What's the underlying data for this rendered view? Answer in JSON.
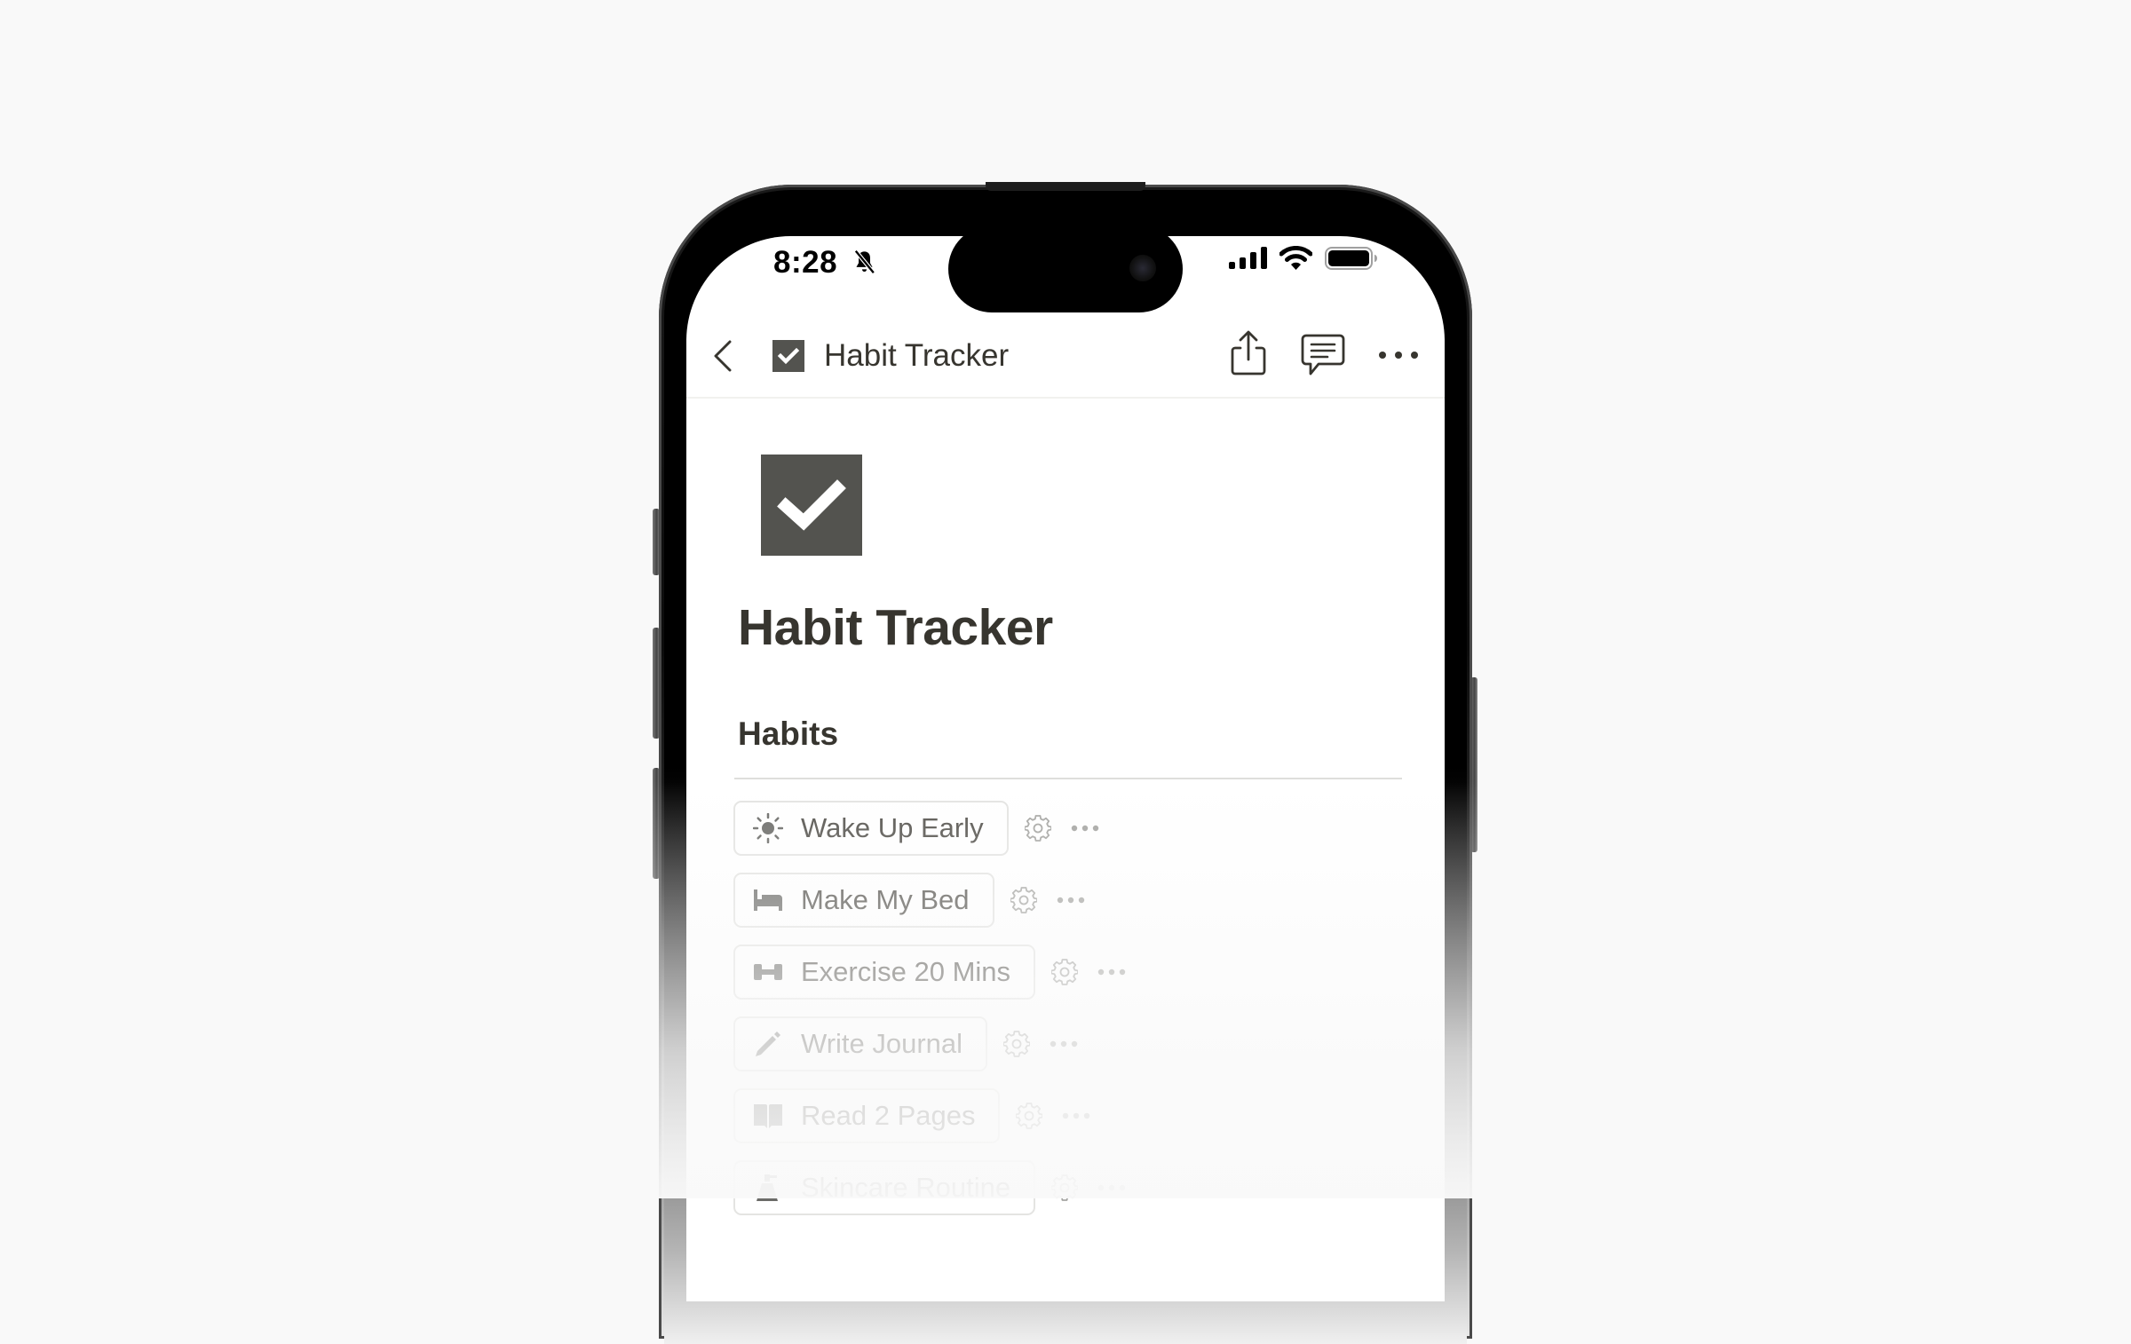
{
  "status_bar": {
    "time": "8:28",
    "silent_mode_icon": "bell-slash-icon",
    "signal_icon": "cellular-signal-icon",
    "wifi_icon": "wifi-icon",
    "battery_icon": "battery-full-icon"
  },
  "nav": {
    "back_icon": "chevron-left-icon",
    "page_icon": "checkbox-checked-icon",
    "title": "Habit Tracker",
    "actions": [
      {
        "name": "share",
        "icon": "share-icon"
      },
      {
        "name": "comments",
        "icon": "comment-icon"
      },
      {
        "name": "more",
        "icon": "ellipsis-icon"
      }
    ]
  },
  "page": {
    "icon": "checkbox-checked-icon",
    "title": "Habit Tracker",
    "section_heading": "Habits",
    "habits": [
      {
        "label": "Wake Up Early",
        "icon": "sun-icon",
        "opacity": 1.0
      },
      {
        "label": "Make My Bed",
        "icon": "bed-icon",
        "opacity": 1.0
      },
      {
        "label": "Exercise 20 Mins",
        "icon": "dumbbell-icon",
        "opacity": 1.0
      },
      {
        "label": "Write Journal",
        "icon": "pencil-icon",
        "opacity": 1.0
      },
      {
        "label": "Read 2 Pages",
        "icon": "book-icon",
        "opacity": 1.0
      },
      {
        "label": "Skincare Routine",
        "icon": "skincare-icon",
        "opacity": 1.0
      }
    ]
  },
  "colors": {
    "background": "#f9f9f9",
    "text_primary": "#37352f",
    "icon_fill": "#53534f",
    "habit_text": "#55534e"
  }
}
